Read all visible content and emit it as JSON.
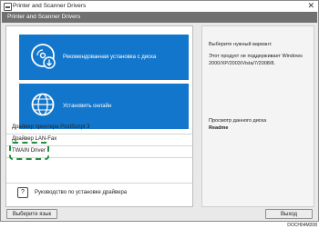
{
  "window": {
    "title": "Printer and Scanner Drivers"
  },
  "header": {
    "title": "Printer and Scanner Drivers"
  },
  "options": {
    "recommended_install": "Рекомендованная установка с диска",
    "install_online": "Установить онлайн"
  },
  "driver_list": [
    {
      "label": "Драйвер принтера PostScript 3"
    },
    {
      "label": "Драйвер LAN-Fax"
    },
    {
      "label": "TWAIN Driver"
    }
  ],
  "help": {
    "label": "Руководство по установке драйвера",
    "icon": "?"
  },
  "right_panel": {
    "prompt": "Выберите нужный вариант.",
    "note": "Этот продукт не поддерживает Windows 2000/XP/2003/Vista/7/2008/8.",
    "browse_label": "Просмотр данного диска",
    "readme": "Readme"
  },
  "footer": {
    "language_button": "Выберите язык",
    "exit_button": "Выход"
  },
  "caption": "DOCH04M208",
  "colors": {
    "accent": "#1277cc",
    "highlight": "#1f8f3e",
    "header": "#6f7070"
  }
}
